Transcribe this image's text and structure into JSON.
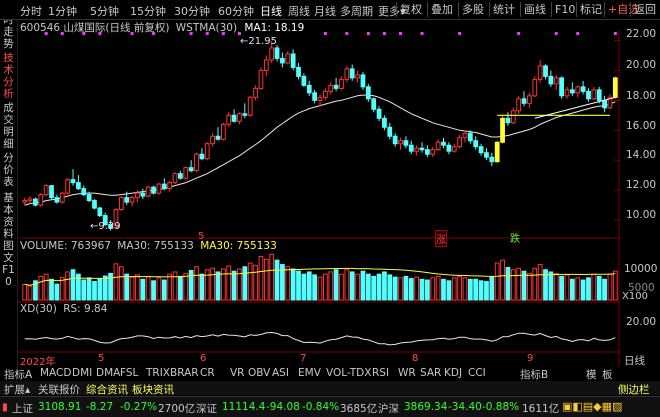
{
  "top_menu": {
    "periods": [
      "分时",
      "1分钟",
      "5分钟",
      "15分钟",
      "30分钟",
      "60分钟",
      "日线",
      "周线",
      "月线",
      "多周期",
      "更多▾"
    ],
    "active_period": "日线",
    "right_buttons": [
      "复权",
      "叠加",
      "多股",
      "统计",
      "画线",
      "F10",
      "标记",
      "+自选",
      "返回"
    ]
  },
  "left_tabs": [
    {
      "label": "分时走势",
      "active": false
    },
    {
      "label": "技术分析",
      "active": true
    },
    {
      "label": "成交明细",
      "active": false
    },
    {
      "label": "分价表",
      "active": false
    },
    {
      "label": "基本资料",
      "active": false
    },
    {
      "label": "图文F10",
      "active": false
    }
  ],
  "stock_info": {
    "code_name": "600546 山煤国际(日线 前复权)",
    "indicator": "WSTMA(30)",
    "ma_label": "MA1: 18.19",
    "high_label": "21.95",
    "low_label": "9.29"
  },
  "volume_info": {
    "volume": "VOLUME: 763967",
    "ma30a": "MA30: 755133",
    "ma30b": "MA30: 755133",
    "x100": "X100"
  },
  "xd_info": {
    "label": "XD(30)",
    "rs": "RS: 9.84"
  },
  "markers": {
    "zhang": "涨",
    "die": "跌",
    "dot5": "5"
  },
  "price_axis": [
    "22.00",
    "20.00",
    "18.00",
    "16.00",
    "14.00",
    "12.00",
    "10.00"
  ],
  "volume_axis": [
    "10000",
    "5000"
  ],
  "xd_axis": [
    "20.00"
  ],
  "x_axis": {
    "year": "2022年",
    "months": [
      "5",
      "6",
      "7",
      "8",
      "9"
    ],
    "right": "日线"
  },
  "bottom_tabs": [
    "指标A",
    "MACD",
    "DMI",
    "DMA",
    "FSL",
    "TRIX",
    "BRAR",
    "CR",
    "VR",
    "OBV",
    "ASI",
    "EMV",
    "VOL-TDX",
    "RSI",
    "WR",
    "SAR",
    "KDJ",
    "CCI",
    "指标B",
    "模",
    "板"
  ],
  "info_tabs": [
    "扩展▴",
    "关联报价",
    "综合资讯",
    "板块资讯"
  ],
  "info_right": "侧边栏",
  "status_bar": {
    "sh": {
      "name": "上证",
      "value": "3108.91",
      "chg": "-8.27",
      "pct": "-0.27%",
      "amt": "2700亿"
    },
    "sz": {
      "name": "深证",
      "value": "11114.4",
      "chg": "-94.08",
      "pct": "-0.84%",
      "amt": "3685亿"
    },
    "hs": {
      "name": "沪深",
      "value": "3869.34",
      "chg": "-34.40",
      "pct": "-0.88%",
      "amt": "1611亿"
    }
  },
  "chart_data": {
    "type": "candlestick",
    "title": "600546 山煤国际(日线 前复权)",
    "ylim": [
      9,
      22.5
    ],
    "candles": [
      [
        11.2,
        11.5,
        11.0,
        11.3
      ],
      [
        11.3,
        11.6,
        11.1,
        11.4
      ],
      [
        11.4,
        11.5,
        10.9,
        11.0
      ],
      [
        11.0,
        11.8,
        10.9,
        11.7
      ],
      [
        11.7,
        12.4,
        11.6,
        12.3
      ],
      [
        12.3,
        12.2,
        11.4,
        11.5
      ],
      [
        11.5,
        11.7,
        11.1,
        11.2
      ],
      [
        11.2,
        11.9,
        11.1,
        11.8
      ],
      [
        11.8,
        12.8,
        11.7,
        12.7
      ],
      [
        12.7,
        13.4,
        12.3,
        12.5
      ],
      [
        12.5,
        13.0,
        12.0,
        12.1
      ],
      [
        12.1,
        12.3,
        11.6,
        11.7
      ],
      [
        11.7,
        11.9,
        11.2,
        11.3
      ],
      [
        11.3,
        11.4,
        10.7,
        10.8
      ],
      [
        10.8,
        10.9,
        10.2,
        10.3
      ],
      [
        10.3,
        10.5,
        9.6,
        9.7
      ],
      [
        9.7,
        10.0,
        9.3,
        9.5
      ],
      [
        9.5,
        10.8,
        9.4,
        10.7
      ],
      [
        10.7,
        11.6,
        10.6,
        11.5
      ],
      [
        11.5,
        11.9,
        11.0,
        11.2
      ],
      [
        11.2,
        11.6,
        10.9,
        11.5
      ],
      [
        11.5,
        12.0,
        11.2,
        11.8
      ],
      [
        11.8,
        12.1,
        11.4,
        11.6
      ],
      [
        11.6,
        12.3,
        11.5,
        12.2
      ],
      [
        12.2,
        12.3,
        11.7,
        11.8
      ],
      [
        11.8,
        12.5,
        11.7,
        12.4
      ],
      [
        12.4,
        12.8,
        12.0,
        12.1
      ],
      [
        12.1,
        12.6,
        11.9,
        12.5
      ],
      [
        12.5,
        13.2,
        12.4,
        13.1
      ],
      [
        13.1,
        13.3,
        12.7,
        12.8
      ],
      [
        12.8,
        13.6,
        12.7,
        13.5
      ],
      [
        13.5,
        14.0,
        13.2,
        13.3
      ],
      [
        13.3,
        14.5,
        13.2,
        14.4
      ],
      [
        14.4,
        14.8,
        14.0,
        14.1
      ],
      [
        14.1,
        15.2,
        14.0,
        15.1
      ],
      [
        15.1,
        15.8,
        14.9,
        15.6
      ],
      [
        15.6,
        16.2,
        15.3,
        15.4
      ],
      [
        15.4,
        16.5,
        15.3,
        16.4
      ],
      [
        16.4,
        17.2,
        16.2,
        17.0
      ],
      [
        17.0,
        17.4,
        16.5,
        16.6
      ],
      [
        16.6,
        17.2,
        16.4,
        17.1
      ],
      [
        17.1,
        17.8,
        16.8,
        17.0
      ],
      [
        17.0,
        18.3,
        16.9,
        18.2
      ],
      [
        18.2,
        19.0,
        18.0,
        18.8
      ],
      [
        18.8,
        20.2,
        18.7,
        20.0
      ],
      [
        20.0,
        21.0,
        19.6,
        20.7
      ],
      [
        20.7,
        21.95,
        20.5,
        21.5
      ],
      [
        21.5,
        21.7,
        20.6,
        20.8
      ],
      [
        20.8,
        21.2,
        20.2,
        20.5
      ],
      [
        20.5,
        21.3,
        20.4,
        21.1
      ],
      [
        21.1,
        21.4,
        20.0,
        20.2
      ],
      [
        20.2,
        20.5,
        19.4,
        19.6
      ],
      [
        19.6,
        19.8,
        18.9,
        19.0
      ],
      [
        19.0,
        19.3,
        18.3,
        18.5
      ],
      [
        18.5,
        18.7,
        17.8,
        18.0
      ],
      [
        18.0,
        18.4,
        17.6,
        18.2
      ],
      [
        18.2,
        18.8,
        18.0,
        18.6
      ],
      [
        18.6,
        19.2,
        18.4,
        19.0
      ],
      [
        19.0,
        19.5,
        18.6,
        18.8
      ],
      [
        18.8,
        19.6,
        18.7,
        19.4
      ],
      [
        19.4,
        20.3,
        19.2,
        20.1
      ],
      [
        20.1,
        20.4,
        19.3,
        19.5
      ],
      [
        19.5,
        20.0,
        19.2,
        19.7
      ],
      [
        19.7,
        19.9,
        18.7,
        18.9
      ],
      [
        18.9,
        19.1,
        17.9,
        18.1
      ],
      [
        18.1,
        18.2,
        17.2,
        17.4
      ],
      [
        17.4,
        17.6,
        16.6,
        16.8
      ],
      [
        16.8,
        17.0,
        16.0,
        16.2
      ],
      [
        16.2,
        16.5,
        15.4,
        15.6
      ],
      [
        15.6,
        15.8,
        14.9,
        15.1
      ],
      [
        15.1,
        15.5,
        14.7,
        15.3
      ],
      [
        15.3,
        15.6,
        14.8,
        15.0
      ],
      [
        15.0,
        15.3,
        14.4,
        14.6
      ],
      [
        14.6,
        15.0,
        14.3,
        14.8
      ],
      [
        14.8,
        15.2,
        14.5,
        14.7
      ],
      [
        14.7,
        15.0,
        14.2,
        14.4
      ],
      [
        14.4,
        14.9,
        14.2,
        14.7
      ],
      [
        14.7,
        15.4,
        14.6,
        15.2
      ],
      [
        15.2,
        15.5,
        14.8,
        15.0
      ],
      [
        15.0,
        15.2,
        14.4,
        14.6
      ],
      [
        14.6,
        15.1,
        14.5,
        14.9
      ],
      [
        14.9,
        15.7,
        14.8,
        15.5
      ],
      [
        15.5,
        16.0,
        15.2,
        15.8
      ],
      [
        15.8,
        16.0,
        15.1,
        15.3
      ],
      [
        15.3,
        15.6,
        14.7,
        14.9
      ],
      [
        14.9,
        15.1,
        14.3,
        14.5
      ],
      [
        14.5,
        14.8,
        14.0,
        14.2
      ],
      [
        14.2,
        14.5,
        13.6,
        13.9
      ],
      [
        13.9,
        15.3,
        13.8,
        15.2
      ],
      [
        15.2,
        17.0,
        15.1,
        16.8
      ],
      [
        16.8,
        17.2,
        16.3,
        16.5
      ],
      [
        16.5,
        17.5,
        16.4,
        17.3
      ],
      [
        17.3,
        18.3,
        17.1,
        18.1
      ],
      [
        18.1,
        18.6,
        17.6,
        17.8
      ],
      [
        17.8,
        18.5,
        17.5,
        18.3
      ],
      [
        18.3,
        19.6,
        18.2,
        19.4
      ],
      [
        19.4,
        20.7,
        19.2,
        20.3
      ],
      [
        20.3,
        20.4,
        19.4,
        19.6
      ],
      [
        19.6,
        20.0,
        18.9,
        19.1
      ],
      [
        19.1,
        19.7,
        18.7,
        19.5
      ],
      [
        19.5,
        19.6,
        18.1,
        18.3
      ],
      [
        18.3,
        18.9,
        18.1,
        18.7
      ],
      [
        18.7,
        19.2,
        18.3,
        18.5
      ],
      [
        18.5,
        19.0,
        18.2,
        18.9
      ],
      [
        18.9,
        19.3,
        18.4,
        18.6
      ],
      [
        18.6,
        18.8,
        17.9,
        18.1
      ],
      [
        18.1,
        18.9,
        18.0,
        18.7
      ],
      [
        18.7,
        18.9,
        17.8,
        18.0
      ],
      [
        18.0,
        18.3,
        17.2,
        17.5
      ],
      [
        17.5,
        18.4,
        17.4,
        18.2
      ],
      [
        18.2,
        19.6,
        18.1,
        19.5
      ]
    ],
    "ma1": [
      11.0,
      11.1,
      11.15,
      11.2,
      11.3,
      11.35,
      11.4,
      11.5,
      11.6,
      11.7,
      11.75,
      11.8,
      11.8,
      11.8,
      11.75,
      11.7,
      11.65,
      11.65,
      11.7,
      11.75,
      11.8,
      11.85,
      11.9,
      11.95,
      12.0,
      12.05,
      12.1,
      12.2,
      12.3,
      12.4,
      12.5,
      12.65,
      12.8,
      12.95,
      13.1,
      13.3,
      13.5,
      13.7,
      13.9,
      14.1,
      14.3,
      14.55,
      14.8,
      15.05,
      15.3,
      15.6,
      15.9,
      16.2,
      16.45,
      16.7,
      16.95,
      17.15,
      17.3,
      17.45,
      17.55,
      17.65,
      17.75,
      17.85,
      17.95,
      18.0,
      18.1,
      18.2,
      18.3,
      18.35,
      18.35,
      18.3,
      18.2,
      18.05,
      17.9,
      17.7,
      17.5,
      17.3,
      17.1,
      16.95,
      16.8,
      16.65,
      16.5,
      16.4,
      16.3,
      16.2,
      16.1,
      16.0,
      15.95,
      15.9,
      15.85,
      15.75,
      15.65,
      15.55,
      15.55,
      15.6,
      15.65,
      15.75,
      15.85,
      15.95,
      16.05,
      16.2,
      16.4,
      16.55,
      16.7,
      16.85,
      16.95,
      17.05,
      17.15,
      17.25,
      17.35,
      17.45,
      17.55,
      17.6,
      17.65,
      17.75,
      17.9
    ],
    "volume": [
      420,
      380,
      520,
      640,
      700,
      560,
      430,
      610,
      760,
      820,
      700,
      540,
      600,
      500,
      580,
      650,
      720,
      980,
      900,
      700,
      620,
      680,
      560,
      640,
      520,
      600,
      540,
      700,
      760,
      640,
      720,
      800,
      900,
      700,
      820,
      860,
      760,
      840,
      920,
      780,
      840,
      900,
      1000,
      940,
      1180,
      1100,
      1240,
      1080,
      960,
      900,
      840,
      780,
      700,
      760,
      680,
      620,
      700,
      760,
      820,
      700,
      820,
      760,
      700,
      780,
      700,
      640,
      700,
      760,
      680,
      620,
      600,
      640,
      580,
      620,
      560,
      540,
      600,
      640,
      560,
      520,
      600,
      640,
      600,
      560,
      560,
      520,
      500,
      620,
      1000,
      1080,
      880,
      820,
      860,
      780,
      720,
      860,
      960,
      820,
      760,
      720,
      640,
      680,
      560,
      600,
      540,
      600,
      700,
      640,
      560,
      700,
      780
    ]
  }
}
